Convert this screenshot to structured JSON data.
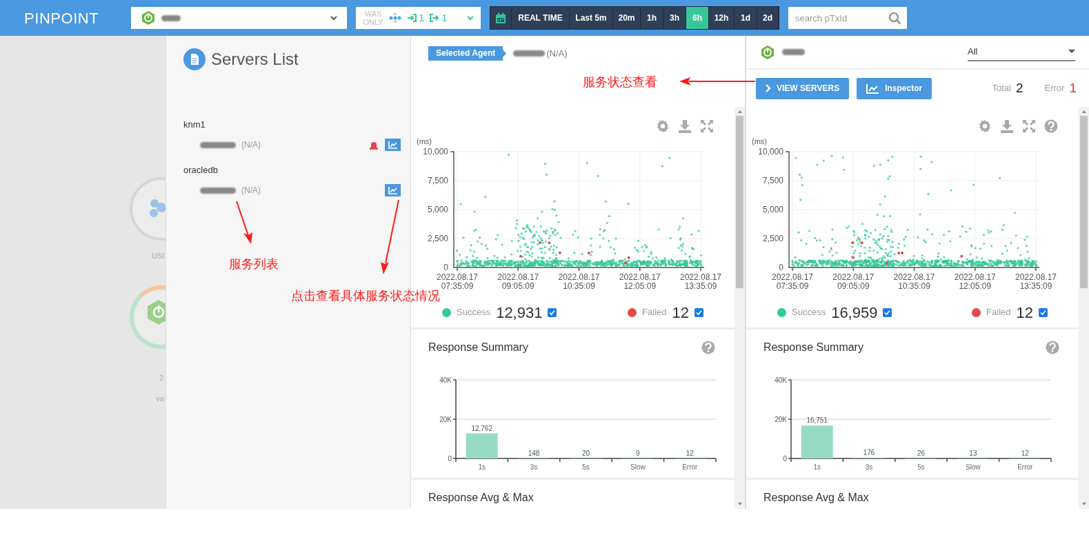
{
  "top_bar": {
    "logo": "PINPOINT",
    "filter": {
      "label": "WAS ONLY",
      "inbound": "1",
      "outbound": "1"
    },
    "time_ranges": [
      {
        "label": "REAL TIME",
        "selected": false
      },
      {
        "label": "Last 5m",
        "selected": false
      },
      {
        "label": "20m",
        "selected": false
      },
      {
        "label": "1h",
        "selected": false
      },
      {
        "label": "3h",
        "selected": false
      },
      {
        "label": "6h",
        "selected": true
      },
      {
        "label": "12h",
        "selected": false
      },
      {
        "label": "1d",
        "selected": false
      },
      {
        "label": "2d",
        "selected": false
      }
    ],
    "search": {
      "placeholder": "search pTxId"
    }
  },
  "server_map": {
    "nodes": [
      {
        "kind": "user",
        "label": "USI"
      },
      {
        "kind": "app",
        "count": "2",
        "label": "va"
      }
    ]
  },
  "servers_panel": {
    "title": "Servers List",
    "groups": [
      {
        "name": "knm1",
        "agents": [
          {
            "status": "(N/A)",
            "alarm": true
          }
        ]
      },
      {
        "name": "oracledb",
        "agents": [
          {
            "status": "(N/A)",
            "alarm": false
          }
        ]
      }
    ]
  },
  "agent_panel": {
    "badge": "Selected Agent",
    "agent_status": "(N/A)",
    "scatter": {
      "help": false,
      "unit": "(ms)",
      "yticks": [
        "10,000",
        "7,500",
        "5,000",
        "2,500",
        "0"
      ],
      "xticks": [
        {
          "date": "2022.08.17",
          "time": "07:35:09"
        },
        {
          "date": "2022.08.17",
          "time": "09:05:09"
        },
        {
          "date": "2022.08.17",
          "time": "10:35:09"
        },
        {
          "date": "2022.08.17",
          "time": "12:05:09"
        },
        {
          "date": "2022.08.17",
          "time": "13:35:09"
        }
      ]
    },
    "legend": [
      {
        "label": "Success",
        "count": "12,931",
        "color": "#34c89a",
        "checked": true
      },
      {
        "label": "Failed",
        "count": "12",
        "color": "#e84848",
        "checked": true
      }
    ],
    "summary": {
      "title": "Response Summary",
      "chart_data": {
        "type": "bar",
        "categories": [
          "1s",
          "3s",
          "5s",
          "Slow",
          "Error"
        ],
        "values": [
          12762,
          148,
          20,
          9,
          12
        ],
        "ylim": [
          0,
          40000
        ],
        "yticks": [
          {
            "value": 0,
            "label": "0"
          },
          {
            "value": 20000,
            "label": "20K"
          },
          {
            "value": 40000,
            "label": "40K"
          }
        ],
        "value_labels": [
          "12,762",
          "148",
          "20",
          "9",
          "12"
        ]
      }
    },
    "next_title": "Response Avg & Max"
  },
  "app_panel": {
    "filter": "All",
    "buttons": [
      {
        "kind": "view_servers",
        "label": "VIEW SERVERS"
      },
      {
        "kind": "inspector",
        "label": "Inspector"
      }
    ],
    "total": {
      "label": "Total",
      "value": "2"
    },
    "error": {
      "label": "Error",
      "value": "1"
    },
    "scatter": {
      "help": true,
      "unit": "(ms)",
      "yticks": [
        "10,000",
        "7,500",
        "5,000",
        "2,500",
        "0"
      ],
      "xticks": [
        {
          "date": "2022.08.17",
          "time": "07:35:09"
        },
        {
          "date": "2022.08.17",
          "time": "09:05:09"
        },
        {
          "date": "2022.08.17",
          "time": "10:35:09"
        },
        {
          "date": "2022.08.17",
          "time": "12:05:09"
        },
        {
          "date": "2022.08.17",
          "time": "13:35:09"
        }
      ]
    },
    "legend": [
      {
        "label": "Success",
        "count": "16,959",
        "color": "#34c89a",
        "checked": true
      },
      {
        "label": "Failed",
        "count": "12",
        "color": "#e84848",
        "checked": true
      }
    ],
    "summary": {
      "title": "Response Summary",
      "chart_data": {
        "type": "bar",
        "categories": [
          "1s",
          "3s",
          "5s",
          "Slow",
          "Error"
        ],
        "values": [
          16751,
          176,
          26,
          13,
          12
        ],
        "ylim": [
          0,
          40000
        ],
        "yticks": [
          {
            "value": 0,
            "label": "0"
          },
          {
            "value": 20000,
            "label": "20K"
          },
          {
            "value": 40000,
            "label": "40K"
          }
        ],
        "value_labels": [
          "16,751",
          "176",
          "26",
          "13",
          "12"
        ]
      }
    },
    "next_title": "Response Avg & Max"
  },
  "annotations": [
    {
      "text": "服务状态查看"
    },
    {
      "text": "服务列表"
    },
    {
      "text": "点击查看具体服务状态情况"
    }
  ]
}
